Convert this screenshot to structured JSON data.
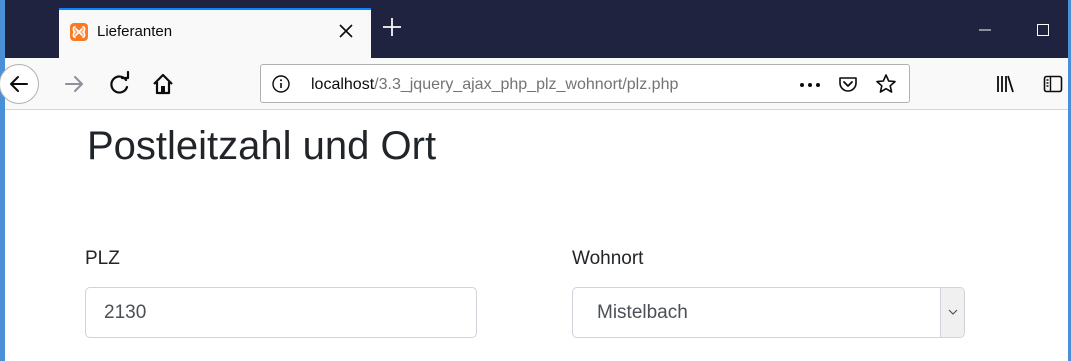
{
  "tab": {
    "title": "Lieferanten",
    "favicon": "xampp-icon"
  },
  "urlbar": {
    "host": "localhost",
    "path": "/3.3_jquery_ajax_php_plz_wohnort/plz.php"
  },
  "page": {
    "title": "Postleitzahl und Ort",
    "plz_label": "PLZ",
    "plz_value": "2130",
    "wohnort_label": "Wohnort",
    "wohnort_selected": "Mistelbach"
  },
  "colors": {
    "titlebar": "#202340",
    "accent": "#0a84ff",
    "favicon": "#fb7a24"
  }
}
